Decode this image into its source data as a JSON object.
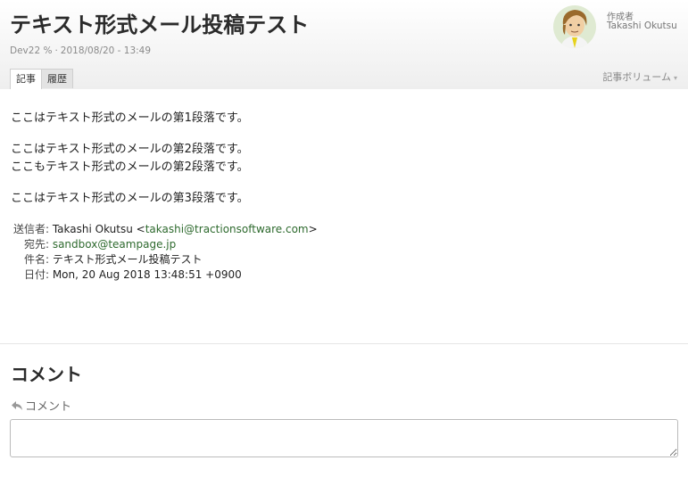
{
  "article": {
    "title": "テキスト形式メール投稿テスト",
    "space": "Dev22",
    "link_symbol": "%",
    "separator": "·",
    "datetime": "2018/08/20 - 13:49"
  },
  "author": {
    "label": "作成者",
    "name": "Takashi Okutsu"
  },
  "tabs": [
    {
      "label": "記事",
      "active": true
    },
    {
      "label": "履歴",
      "active": false
    }
  ],
  "volume": {
    "label": "記事ボリューム",
    "caret": "▾"
  },
  "body": {
    "paragraphs": [
      [
        "ここはテキスト形式のメールの第1段落です。"
      ],
      [
        "ここはテキスト形式のメールの第2段落です。",
        "ここもテキスト形式のメールの第2段落です。"
      ],
      [
        "ここはテキスト形式のメールの第3段落です。"
      ]
    ]
  },
  "mail": {
    "from_label": "送信者:",
    "from_name": "Takashi Okutsu",
    "from_open": "<",
    "from_email": "takashi@tractionsoftware.com",
    "from_close": ">",
    "to_label": "宛先:",
    "to_email": "sandbox@teampage.jp",
    "subject_label": "件名:",
    "subject": "テキスト形式メール投稿テスト",
    "date_label": "日付:",
    "date": "Mon, 20 Aug 2018 13:48:51 +0900"
  },
  "comments": {
    "title": "コメント",
    "link_label": "コメント",
    "reply_icon": "reply-arrow-icon"
  },
  "colors": {
    "link": "#2e6a2e",
    "meta": "#8a8a8a"
  }
}
